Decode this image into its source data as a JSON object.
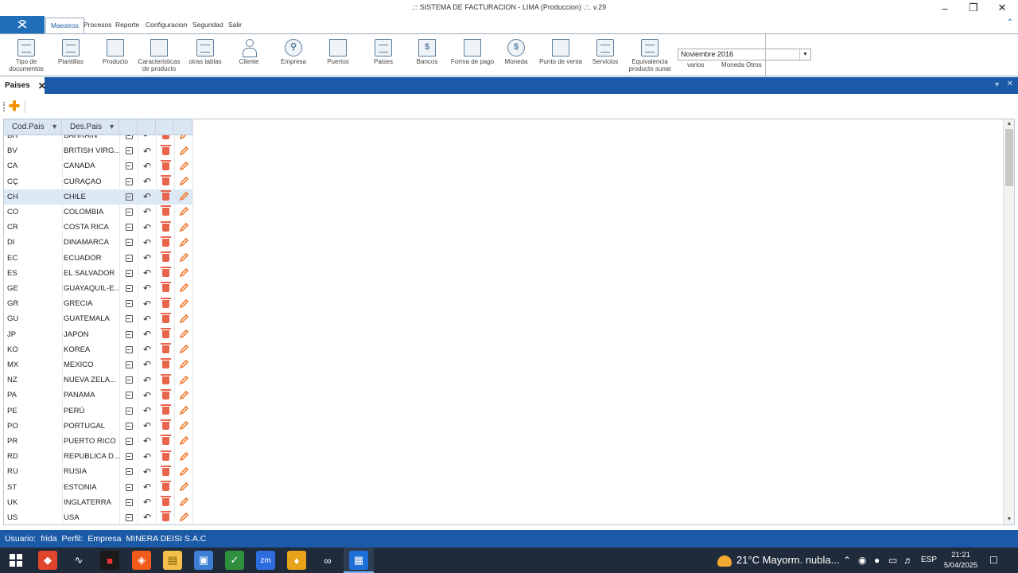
{
  "window": {
    "title": ".:: SISTEMA DE FACTURACION - LIMA (Produccion) .::. v.29"
  },
  "ribbon_tabs": [
    "Maestros",
    "Procesos",
    "Reporte",
    "Configuracion",
    "Seguridad",
    "Salir"
  ],
  "ribbon_buttons": [
    {
      "label": "Tipo de documentos",
      "icon": "document-icon"
    },
    {
      "label": "Plantillas",
      "icon": "template-icon"
    },
    {
      "label": "Producto",
      "icon": "product-icon"
    },
    {
      "label": "Caracteristicas de producto",
      "icon": "features-icon"
    },
    {
      "label": "otras tablas",
      "icon": "tables-icon"
    },
    {
      "label": "Cliente",
      "icon": "client-icon"
    },
    {
      "label": "Empresa",
      "icon": "company-icon"
    },
    {
      "label": "Puertos",
      "icon": "ports-icon"
    },
    {
      "label": "Paises",
      "icon": "countries-icon"
    },
    {
      "label": "Bancos",
      "icon": "banks-icon"
    },
    {
      "label": "Forma de pago",
      "icon": "payment-icon"
    },
    {
      "label": "Moneda",
      "icon": "currency-icon"
    },
    {
      "label": "Punto de venta",
      "icon": "pos-icon"
    },
    {
      "label": "Servicios",
      "icon": "services-icon"
    },
    {
      "label": "Equivalencia producto sunat",
      "icon": "equivalence-icon"
    }
  ],
  "period": {
    "value": "Noviembre 2016",
    "varios_label": "varios",
    "moneda_otros_label": "Moneda Otros"
  },
  "doc_tab": {
    "label": "Paises"
  },
  "grid": {
    "columns": [
      "Cod.Pais",
      "Des.Pais"
    ],
    "rows": [
      {
        "code": "BH",
        "desc": "BAHRAIN"
      },
      {
        "code": "BV",
        "desc": "BRITISH VIRG..."
      },
      {
        "code": "CA",
        "desc": "CANADA"
      },
      {
        "code": "CÇ",
        "desc": "CURAÇAO"
      },
      {
        "code": "CH",
        "desc": "CHILE"
      },
      {
        "code": "CO",
        "desc": "COLOMBIA"
      },
      {
        "code": "CR",
        "desc": "COSTA RICA"
      },
      {
        "code": "DI",
        "desc": "DINAMARCA"
      },
      {
        "code": "EC",
        "desc": "ECUADOR"
      },
      {
        "code": "ES",
        "desc": "EL SALVADOR"
      },
      {
        "code": "GE",
        "desc": "GUAYAQUIL-E..."
      },
      {
        "code": "GR",
        "desc": "GRECIA"
      },
      {
        "code": "GU",
        "desc": "GUATEMALA"
      },
      {
        "code": "JP",
        "desc": "JAPON"
      },
      {
        "code": "KO",
        "desc": "KOREA"
      },
      {
        "code": "MX",
        "desc": "MEXICO"
      },
      {
        "code": "NZ",
        "desc": "NUEVA ZELA..."
      },
      {
        "code": "PA",
        "desc": "PANAMA"
      },
      {
        "code": "PE",
        "desc": "PERÚ"
      },
      {
        "code": "PO",
        "desc": "PORTUGAL"
      },
      {
        "code": "PR",
        "desc": "PUERTO RICO"
      },
      {
        "code": "RD",
        "desc": "REPUBLICA D..."
      },
      {
        "code": "RU",
        "desc": "RUSIA"
      },
      {
        "code": "ST",
        "desc": "ESTONIA"
      },
      {
        "code": "UK",
        "desc": "INGLATERRA"
      },
      {
        "code": "US",
        "desc": "USA"
      }
    ],
    "selected_code": "CH"
  },
  "status": {
    "user_label": "Usuario:",
    "user": "frida",
    "profile_label": "Perfil:",
    "profile": "Empresa",
    "company": "MINERA DEISI S.A.C"
  },
  "taskbar": {
    "weather": "21°C  Mayorm. nubla...",
    "lang": "ESP",
    "time": "21:21",
    "date": "5/04/2025"
  },
  "colors": {
    "accent": "#1b5aa6",
    "selected_row": "#dde8f5",
    "add_button": "#f29100",
    "delete_icon": "#e8644a",
    "edit_icon": "#f07020"
  }
}
